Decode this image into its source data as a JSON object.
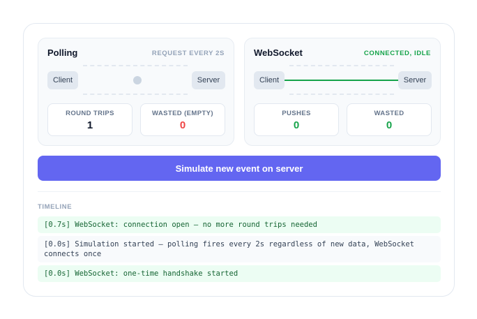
{
  "polling": {
    "title": "Polling",
    "status": "REQUEST EVERY 2S",
    "client_label": "Client",
    "server_label": "Server",
    "stats": [
      {
        "label": "ROUND TRIPS",
        "value": "1"
      },
      {
        "label": "WASTED (EMPTY)",
        "value": "0"
      }
    ]
  },
  "websocket": {
    "title": "WebSocket",
    "status": "CONNECTED, IDLE",
    "client_label": "Client",
    "server_label": "Server",
    "stats": [
      {
        "label": "PUSHES",
        "value": "0"
      },
      {
        "label": "WASTED",
        "value": "0"
      }
    ]
  },
  "actions": {
    "simulate_label": "Simulate new event on server"
  },
  "timeline": {
    "title": "TIMELINE",
    "entries": [
      {
        "text": "[0.7s] WebSocket: connection open — no more round trips needed",
        "kind": "websocket"
      },
      {
        "text": "[0.0s] Simulation started — polling fires every 2s regardless of new data, WebSocket connects once",
        "kind": "info"
      },
      {
        "text": "[0.0s] WebSocket: one-time handshake started",
        "kind": "websocket"
      }
    ]
  },
  "colors": {
    "accent": "#6366f1",
    "success": "#16a34a",
    "danger": "#ef4444",
    "muted": "#94a3b8"
  }
}
